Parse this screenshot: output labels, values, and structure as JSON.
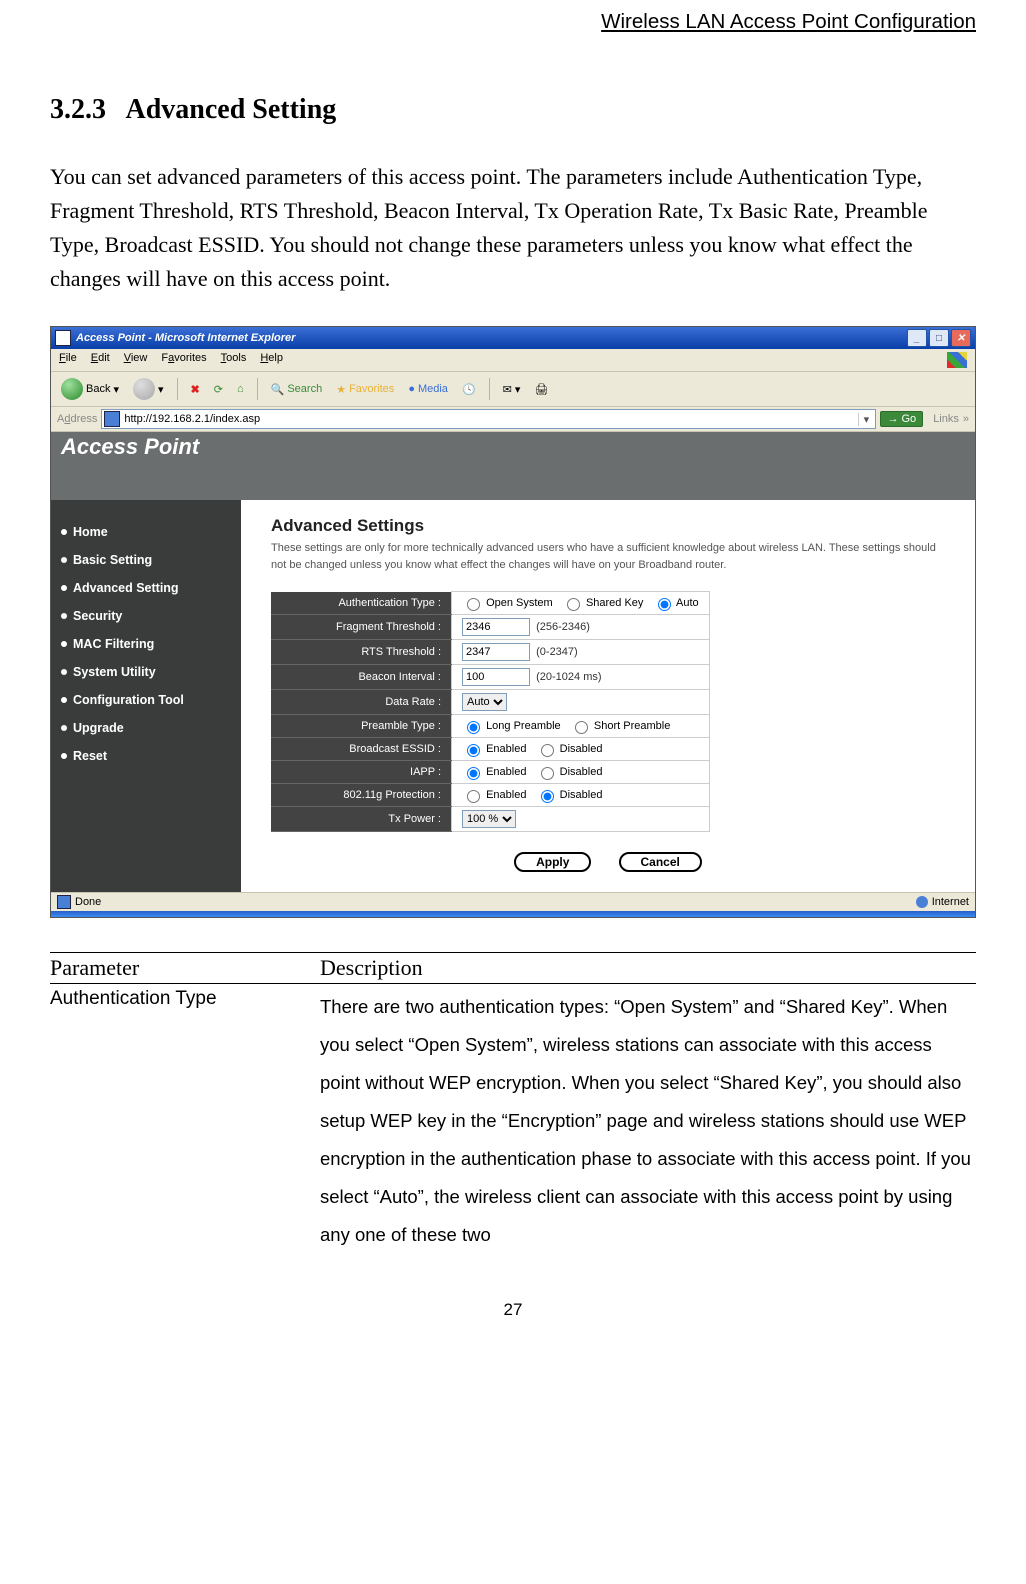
{
  "running_head": "Wireless LAN Access Point Configuration",
  "section_number": "3.2.3",
  "section_title": "Advanced Setting",
  "intro_paragraph": "You can set advanced parameters of this access point. The parameters include Authentication Type, Fragment Threshold, RTS Threshold, Beacon Interval, Tx Operation Rate, Tx Basic Rate, Preamble Type, Broadcast ESSID. You should not change these parameters unless you know what effect the changes will have on this access point.",
  "browser": {
    "window_title": "Access Point - Microsoft Internet Explorer",
    "menus": [
      "File",
      "Edit",
      "View",
      "Favorites",
      "Tools",
      "Help"
    ],
    "toolbar": {
      "back": "Back",
      "search": "Search",
      "favorites": "Favorites",
      "media": "Media"
    },
    "address_label": "Address",
    "url": "http://192.168.2.1/index.asp",
    "go": "Go",
    "links": "Links",
    "status_left": "Done",
    "status_right": "Internet"
  },
  "ap_page": {
    "banner": "Access Point",
    "sidebar_items": [
      "Home",
      "Basic Setting",
      "Advanced Setting",
      "Security",
      "MAC Filtering",
      "System Utility",
      "Configuration Tool",
      "Upgrade",
      "Reset"
    ],
    "pane_title": "Advanced Settings",
    "pane_desc": "These settings are only for more technically advanced users who have a sufficient knowledge about wireless LAN. These settings should not be changed unless you know what effect the changes will have on your Broadband router.",
    "rows": {
      "auth_type": {
        "label": "Authentication Type :",
        "options": [
          "Open System",
          "Shared Key",
          "Auto"
        ],
        "selected": "Auto"
      },
      "frag": {
        "label": "Fragment Threshold :",
        "value": "2346",
        "hint": "(256-2346)"
      },
      "rts": {
        "label": "RTS Threshold :",
        "value": "2347",
        "hint": "(0-2347)"
      },
      "beacon": {
        "label": "Beacon Interval :",
        "value": "100",
        "hint": "(20-1024 ms)"
      },
      "data_rate": {
        "label": "Data Rate :",
        "value": "Auto"
      },
      "preamble": {
        "label": "Preamble Type :",
        "options": [
          "Long Preamble",
          "Short Preamble"
        ],
        "selected": "Long Preamble"
      },
      "essid": {
        "label": "Broadcast ESSID :",
        "options": [
          "Enabled",
          "Disabled"
        ],
        "selected": "Enabled"
      },
      "iapp": {
        "label": "IAPP :",
        "options": [
          "Enabled",
          "Disabled"
        ],
        "selected": "Enabled"
      },
      "protection": {
        "label": "802.11g Protection :",
        "options": [
          "Enabled",
          "Disabled"
        ],
        "selected": "Disabled"
      },
      "txpower": {
        "label": "Tx Power :",
        "value": "100 %"
      }
    },
    "apply": "Apply",
    "cancel": "Cancel"
  },
  "param_table": {
    "head_param": "Parameter",
    "head_desc": "Description",
    "row1_param": "Authentication Type",
    "row1_desc": "There are two authentication types: “Open System” and “Shared Key”. When you select “Open System”, wireless stations can associate with this access point without WEP encryption. When you select “Shared Key”, you should also setup WEP key in the “Encryption” page and wireless stations should use WEP encryption in the authentication phase to associate with this access point. If you select “Auto”, the wireless client can associate with this access point by using any one of these two"
  },
  "page_number": "27"
}
